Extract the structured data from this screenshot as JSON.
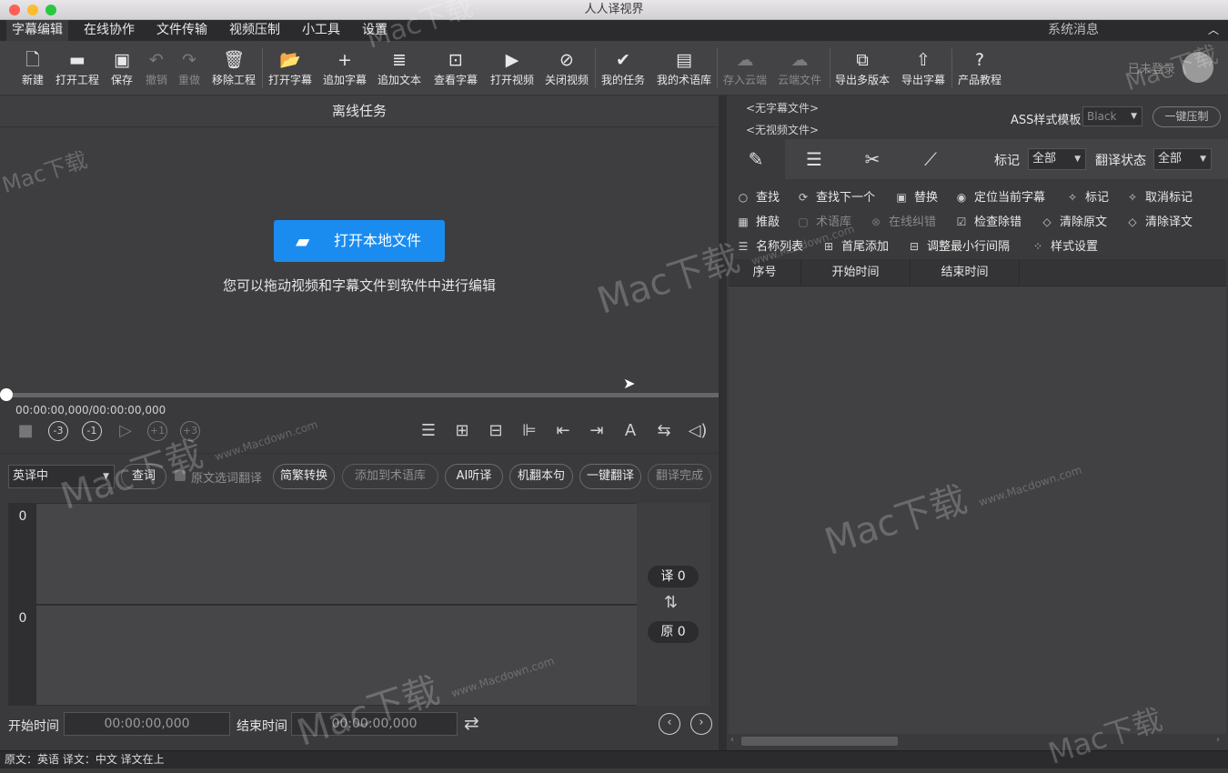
{
  "window": {
    "title": "人人译视界"
  },
  "menu": {
    "items": [
      "字幕编辑",
      "在线协作",
      "文件传输",
      "视频压制",
      "小工具",
      "设置"
    ],
    "system_messages": "系统消息",
    "collapse_icon": "chevron-up-icon"
  },
  "toolbar": {
    "items": [
      {
        "label": "新建",
        "icon": "new-file-icon"
      },
      {
        "label": "打开工程",
        "icon": "folder-icon"
      },
      {
        "label": "保存",
        "icon": "save-icon"
      },
      {
        "label": "撤销",
        "icon": "undo-icon"
      },
      {
        "label": "重做",
        "icon": "redo-icon"
      },
      {
        "label": "移除工程",
        "icon": "trash-icon"
      },
      {
        "label": "打开字幕",
        "icon": "open-folder-icon"
      },
      {
        "label": "追加字幕",
        "icon": "plus-icon"
      },
      {
        "label": "追加文本",
        "icon": "text-doc-icon"
      },
      {
        "label": "查看字幕",
        "icon": "view-subtitle-icon"
      },
      {
        "label": "打开视频",
        "icon": "video-camera-icon"
      },
      {
        "label": "关闭视频",
        "icon": "video-off-icon"
      },
      {
        "label": "我的任务",
        "icon": "clipboard-check-icon"
      },
      {
        "label": "我的术语库",
        "icon": "glossary-icon"
      },
      {
        "label": "存入云端",
        "icon": "cloud-upload-icon"
      },
      {
        "label": "云端文件",
        "icon": "cloud-file-icon"
      },
      {
        "label": "导出多版本",
        "icon": "layers-export-icon"
      },
      {
        "label": "导出字幕",
        "icon": "file-export-icon"
      },
      {
        "label": "产品教程",
        "icon": "help-icon"
      }
    ],
    "login_text": "已未登录"
  },
  "left": {
    "header": "离线任务",
    "open_local": "打开本地文件",
    "drag_hint": "您可以拖动视频和字幕文件到软件中进行编辑",
    "time_readout": "00:00:00,000/00:00:00,000",
    "playback": {
      "rew3": "-3",
      "rew1": "-1",
      "fwd1": "+1",
      "fwd3": "+3"
    },
    "translate_bar": {
      "direction": "英译中",
      "lookup": "查词",
      "src_select_translate": "原文选词翻译",
      "simp_trad": "简繁转换",
      "add_glossary": "添加到术语库",
      "ai_listen": "AI听译",
      "machine_sentence": "机翻本句",
      "one_click": "一键翻译",
      "done": "翻译完成"
    },
    "editor_top_count": "0",
    "editor_bottom_count": "0",
    "translated_badge": "译 0",
    "original_badge": "原 0",
    "start_time_label": "开始时间",
    "start_time_value": "00:00:00,000",
    "end_time_label": "结束时间",
    "end_time_value": "00:00:00,000"
  },
  "right": {
    "no_subtitle": "<无字幕文件>",
    "no_video": "<无视频文件>",
    "ass_label": "ASS样式模板",
    "ass_value": "Black",
    "burn_button": "一键压制",
    "mark_label": "标记",
    "mark_value": "全部",
    "status_label": "翻译状态",
    "status_value": "全部",
    "actions_row1": [
      "查找",
      "查找下一个",
      "替换",
      "定位当前字幕",
      "标记",
      "取消标记"
    ],
    "actions_row2": [
      "推敲",
      "术语库",
      "在线纠错",
      "检查除错",
      "清除原文",
      "清除译文"
    ],
    "actions_row3": [
      "名称列表",
      "首尾添加",
      "调整最小行间隔",
      "样式设置"
    ],
    "table_headers": [
      "序号",
      "开始时间",
      "结束时间"
    ]
  },
  "status": {
    "text": "原文：英语 译文：中文   译文在上"
  },
  "watermark": {
    "brand": "Mac下载",
    "site": "www.Macdown.com"
  }
}
